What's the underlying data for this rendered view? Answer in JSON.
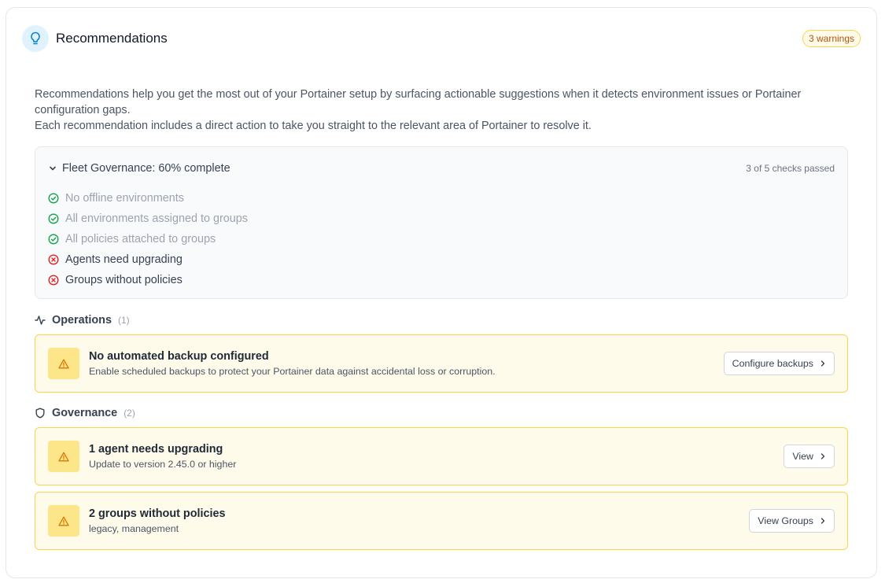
{
  "header": {
    "title": "Recommendations",
    "badge": "3 warnings"
  },
  "intro": {
    "line1": "Recommendations help you get the most out of your Portainer setup by surfacing actionable suggestions when it detects environment issues or Portainer configuration gaps.",
    "line2": "Each recommendation includes a direct action to take you straight to the relevant area of Portainer to resolve it."
  },
  "fleet": {
    "title": "Fleet Governance: 60% complete",
    "summary": "3 of 5 checks passed",
    "checks": [
      {
        "label": "No offline environments",
        "status": "pass"
      },
      {
        "label": "All environments assigned to groups",
        "status": "pass"
      },
      {
        "label": "All policies attached to groups",
        "status": "pass"
      },
      {
        "label": "Agents need upgrading",
        "status": "fail"
      },
      {
        "label": "Groups without policies",
        "status": "fail"
      }
    ]
  },
  "operations": {
    "title": "Operations",
    "count": "(1)",
    "items": [
      {
        "title": "No automated backup configured",
        "desc": "Enable scheduled backups to protect your Portainer data against accidental loss or corruption.",
        "action": "Configure backups"
      }
    ]
  },
  "governance": {
    "title": "Governance",
    "count": "(2)",
    "items": [
      {
        "title": "1 agent needs upgrading",
        "desc": "Update to version 2.45.0 or higher",
        "action": "View"
      },
      {
        "title": "2 groups without policies",
        "desc": "legacy, management",
        "action": "View Groups"
      }
    ]
  },
  "colors": {
    "pass": "#16a34a",
    "fail": "#dc2626",
    "warning": "#d97706",
    "accent": "#0284c7"
  }
}
